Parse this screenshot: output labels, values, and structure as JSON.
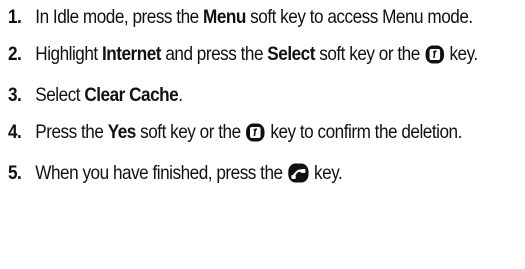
{
  "steps": [
    {
      "number": "1.",
      "t1": "In Idle mode, press the ",
      "b1": "Menu",
      "t2": " soft key to access Menu mode."
    },
    {
      "number": "2.",
      "t1": "Highlight ",
      "b1": "Internet",
      "t2": " and press the ",
      "b2": "Select",
      "t3": " soft key or the ",
      "icon": "ok-key-icon",
      "t4": " key."
    },
    {
      "number": "3.",
      "t1": "Select ",
      "b1": "Clear Cache",
      "t2": "."
    },
    {
      "number": "4.",
      "t1": "Press the ",
      "b1": "Yes",
      "t2": " soft key or the ",
      "icon": "ok-key-icon",
      "t3": " key to confirm the deletion."
    },
    {
      "number": "5.",
      "t1": "When you have finished, press the ",
      "icon": "end-key-icon",
      "t2": " key."
    }
  ]
}
